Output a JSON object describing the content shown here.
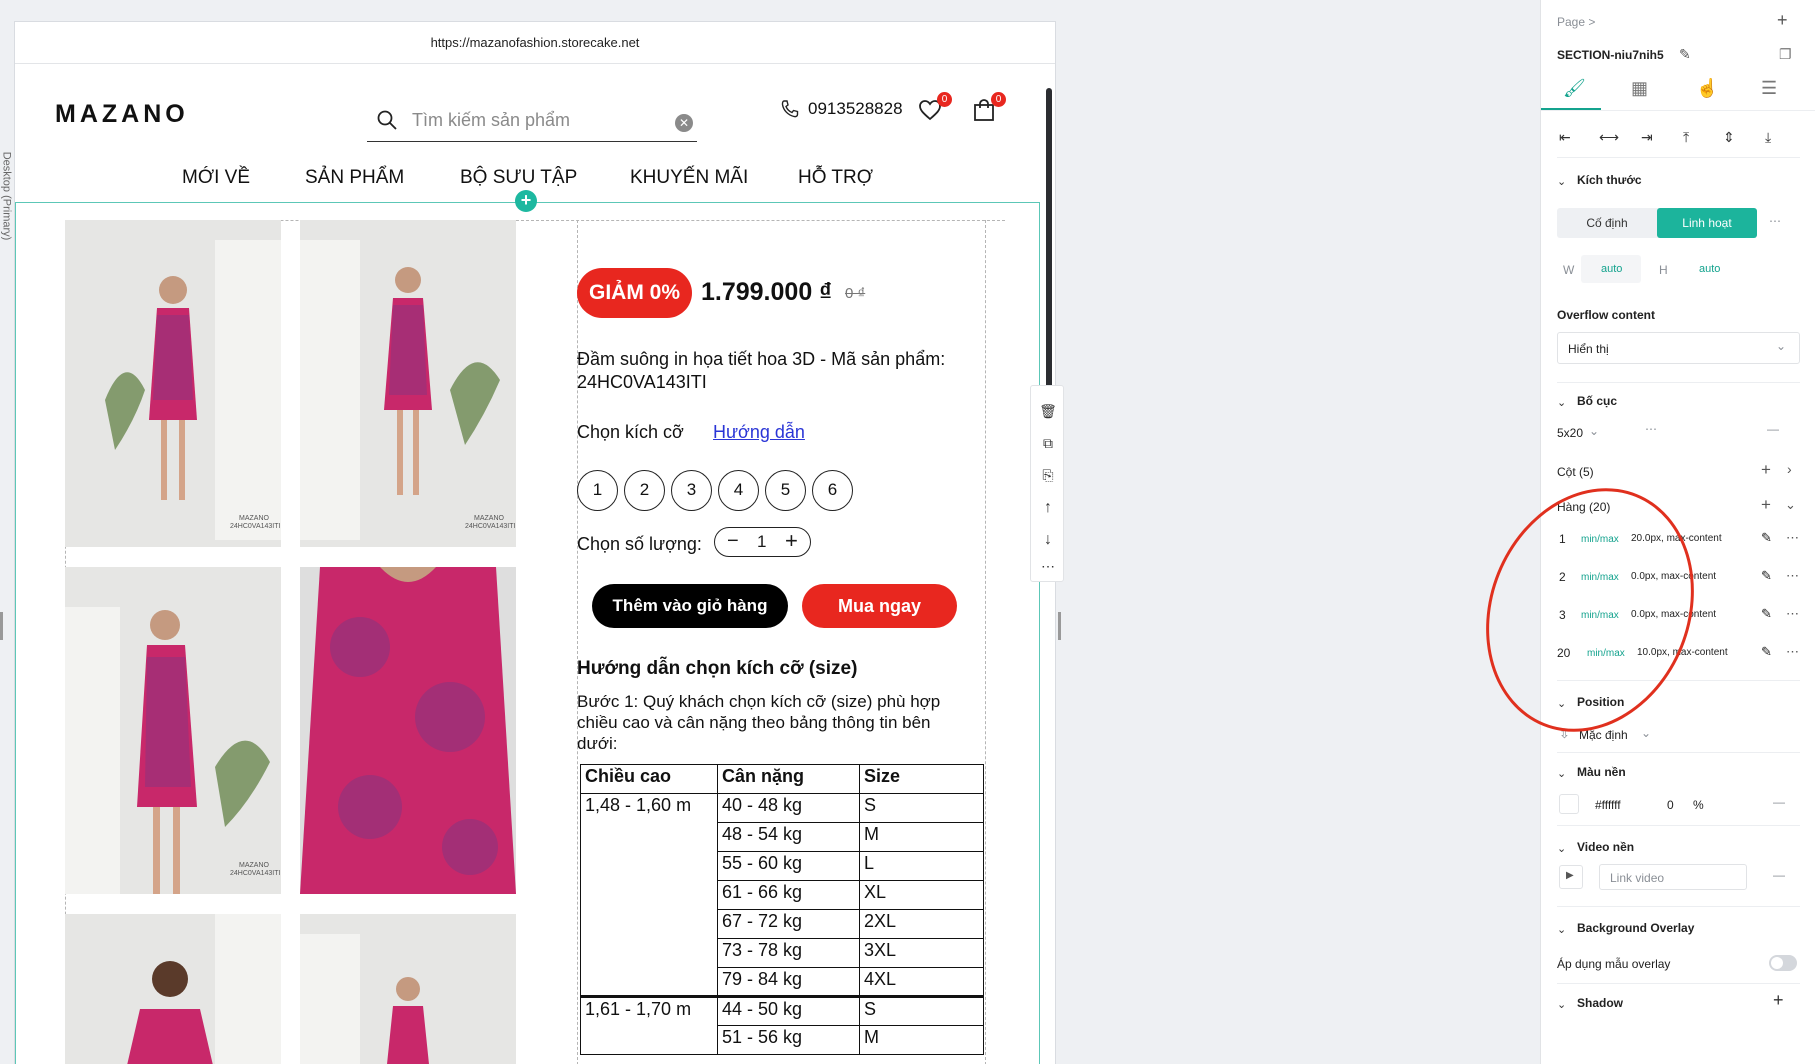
{
  "canvas": {
    "side_label": "Desktop (Primary)"
  },
  "browser": {
    "url": "https://mazanofashion.storecake.net"
  },
  "site": {
    "logo": "MAZANO",
    "search_placeholder": "Tìm kiếm sản phẩm",
    "phone": "0913528828",
    "wishlist_count": "0",
    "cart_count": "0",
    "nav": [
      "MỚI VỀ",
      "SẢN PHẨM",
      "BỘ SƯU TẬP",
      "KHUYẾN MÃI",
      "HỖ TRỢ"
    ]
  },
  "product": {
    "discount": "GIẢM 0%",
    "price": "1.799.000 ₫",
    "old_price": "0 ₫",
    "name": "Đầm suông in họa tiết hoa 3D - Mã sản phẩm: 24HC0VA143ITI",
    "size_label": "Chọn kích cỡ",
    "size_guide_link": "Hướng dẫn",
    "sizes": [
      "1",
      "2",
      "3",
      "4",
      "5",
      "6"
    ],
    "qty_label": "Chọn số lượng:",
    "qty_value": "1",
    "add_to_cart": "Thêm vào giỏ hàng",
    "buy_now": "Mua ngay",
    "guide_title": "Hướng dẫn chọn kích cỡ (size)",
    "guide_text": "Bước 1: Quý khách chọn kích cỡ (size) phù hợp chiều cao và cân nặng theo bảng thông tin bên dưới:",
    "photo_tag": "MAZANO 24HC0VA143ITI"
  },
  "size_table": {
    "headers": [
      "Chiều cao",
      "Cân nặng",
      "Size"
    ],
    "group1_height": "1,48 - 1,60 m",
    "group1": [
      [
        "40 - 48 kg",
        "S"
      ],
      [
        "48 - 54 kg",
        "M"
      ],
      [
        "55 - 60 kg",
        "L"
      ],
      [
        "61 - 66 kg",
        "XL"
      ],
      [
        "67 - 72 kg",
        "2XL"
      ],
      [
        "73 - 78 kg",
        "3XL"
      ],
      [
        "79 - 84 kg",
        "4XL"
      ]
    ],
    "group2_height": "1,61 - 1,70 m",
    "group2": [
      [
        "44 - 50 kg",
        "S"
      ],
      [
        "51 - 56 kg",
        "M"
      ]
    ]
  },
  "panel": {
    "breadcrumb": "Page >",
    "section_name": "SECTION-niu7nih5",
    "size_title": "Kích thước",
    "fixed": "Cố định",
    "flexible": "Linh hoạt",
    "w_label": "W",
    "w_value": "auto",
    "h_label": "H",
    "h_value": "auto",
    "overflow_title": "Overflow content",
    "overflow_value": "Hiển thị",
    "layout_title": "Bố cục",
    "grid_value": "5x20",
    "columns": "Cột (5)",
    "rows": "Hàng (20)",
    "row_items": [
      {
        "index": "1",
        "mode": "min/max",
        "value": "20.0px, max-content"
      },
      {
        "index": "2",
        "mode": "min/max",
        "value": "0.0px, max-content"
      },
      {
        "index": "3",
        "mode": "min/max",
        "value": "0.0px, max-content"
      },
      {
        "index": "20",
        "mode": "min/max",
        "value": "10.0px, max-content"
      }
    ],
    "position_title": "Position",
    "position_value": "Mặc định",
    "bg_title": "Màu nền",
    "bg_color": "#ffffff",
    "bg_opacity": "0",
    "bg_percent": "%",
    "video_title": "Video nền",
    "video_placeholder": "Link video",
    "overlay_title": "Background Overlay",
    "overlay_label": "Áp dụng mẫu overlay",
    "shadow_title": "Shadow"
  },
  "colors": {
    "accent": "#1cb49c",
    "brand_red": "#e8271f",
    "annotation": "#e0301e"
  }
}
